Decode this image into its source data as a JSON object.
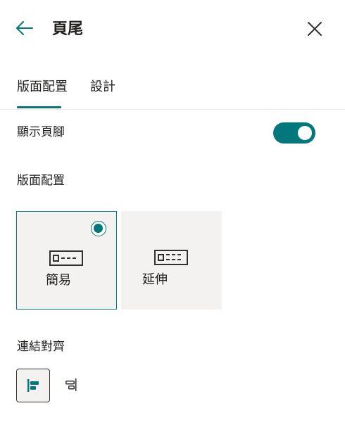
{
  "header": {
    "title": "頁尾",
    "back_icon": "arrow-left-icon",
    "close_icon": "close-icon"
  },
  "tabs": [
    {
      "label": "版面配置",
      "selected": true
    },
    {
      "label": "設計",
      "selected": false
    }
  ],
  "show_footer": {
    "label": "顯示頁腳",
    "on": true
  },
  "layout": {
    "label": "版面配置",
    "options": [
      {
        "label": "簡易",
        "selected": true,
        "icon": "simple-footer-icon"
      },
      {
        "label": "延伸",
        "selected": false,
        "icon": "extended-footer-icon"
      }
    ]
  },
  "link_alignment": {
    "label": "連結對齊",
    "options": [
      {
        "icon": "align-left-icon",
        "selected": true
      },
      {
        "icon": "align-right-icon",
        "selected": false
      }
    ]
  },
  "colors": {
    "accent": "#03787c",
    "card_background": "#f3f2f1",
    "text": "#201f1e"
  }
}
